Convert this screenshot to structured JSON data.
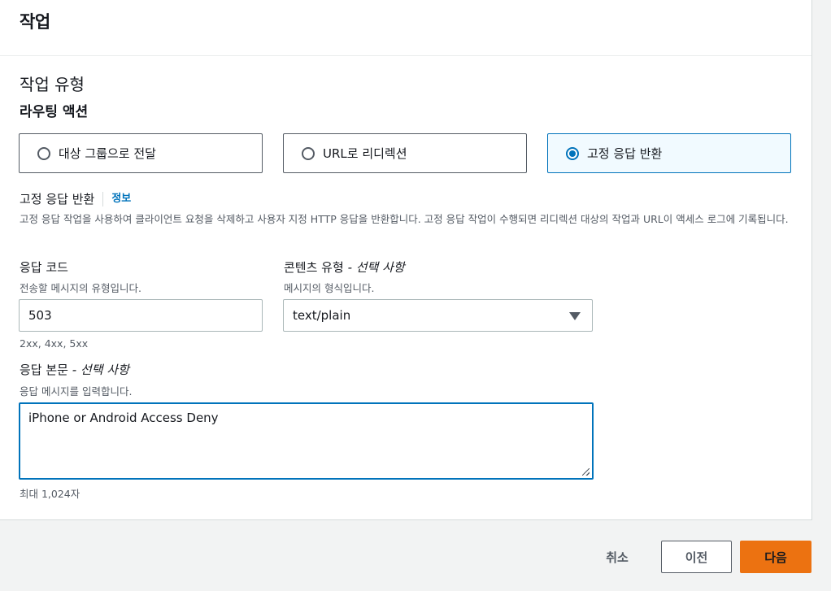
{
  "panel": {
    "title": "작업",
    "section_title": "작업 유형",
    "subsection_title": "라우팅 액션",
    "routing_options": [
      {
        "label": "대상 그룹으로 전달",
        "selected": false
      },
      {
        "label": "URL로 리디렉션",
        "selected": false
      },
      {
        "label": "고정 응답 반환",
        "selected": true
      }
    ],
    "fixed_response": {
      "label": "고정 응답 반환",
      "info_link": "정보",
      "description": "고정 응답 작업을 사용하여 클라이언트 요청을 삭제하고 사용자 지정 HTTP 응답을 반환합니다. 고정 응답 작업이 수행되면 리디렉션 대상의 작업과 URL이 액세스 로그에 기록됩니다."
    },
    "response_code": {
      "label": "응답 코드",
      "description": "전송할 메시지의 유형입니다.",
      "value": "503",
      "constraint": "2xx, 4xx, 5xx"
    },
    "content_type": {
      "label": "콘텐츠 유형",
      "optional": "- 선택 사항",
      "description": "메시지의 형식입니다.",
      "value": "text/plain"
    },
    "response_body": {
      "label": "응답 본문",
      "optional": "- 선택 사항",
      "description": "응답 메시지를 입력합니다.",
      "value": "iPhone or Android Access Deny",
      "constraint": "최대 1,024자"
    }
  },
  "footer": {
    "cancel_label": "취소",
    "previous_label": "이전",
    "next_label": "다음"
  },
  "colors": {
    "accent": "#0073bb",
    "primary_button": "#ec7211",
    "page_background": "#f2f3f3"
  }
}
